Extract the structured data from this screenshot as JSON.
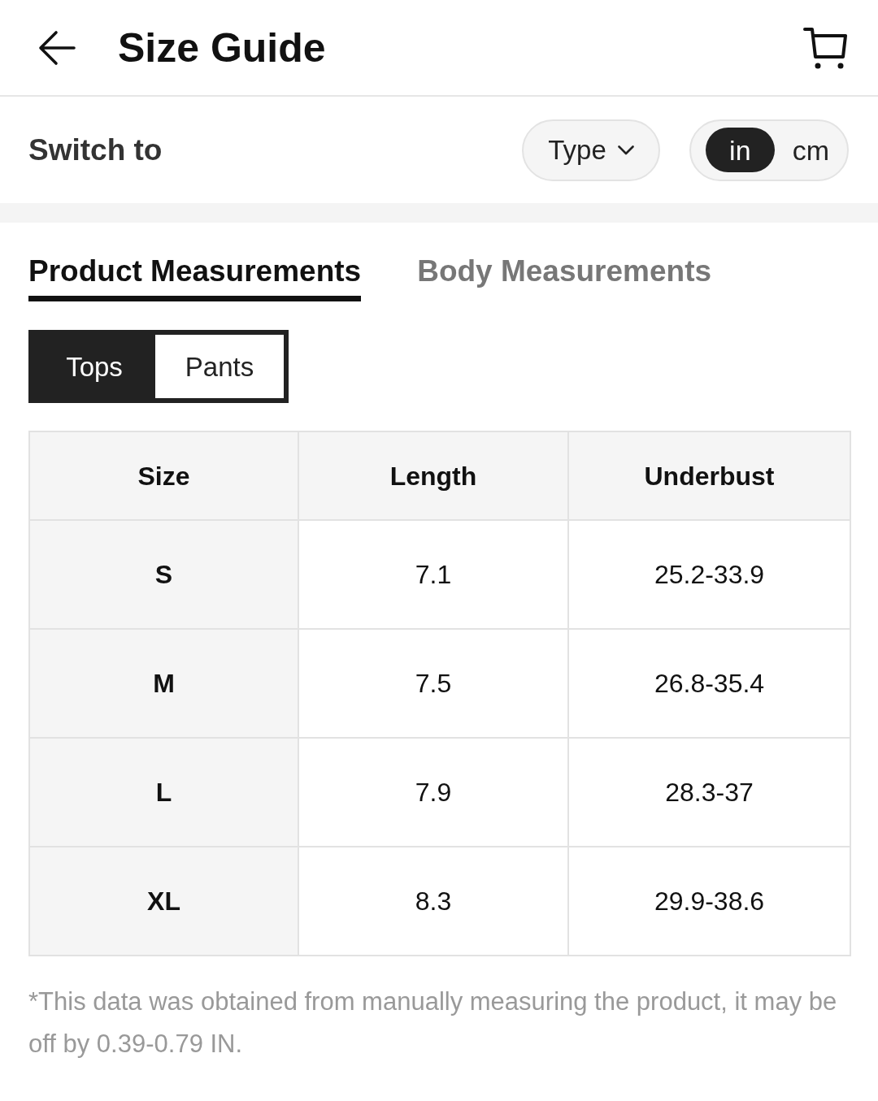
{
  "header": {
    "title": "Size Guide"
  },
  "switch": {
    "label": "Switch to",
    "type_dropdown": {
      "label": "Type"
    },
    "units": [
      {
        "label": "in",
        "selected": true
      },
      {
        "label": "cm",
        "selected": false
      }
    ]
  },
  "tabs": [
    {
      "label": "Product Measurements",
      "selected": true
    },
    {
      "label": "Body Measurements",
      "selected": false
    }
  ],
  "categories": [
    {
      "label": "Tops",
      "selected": true
    },
    {
      "label": "Pants",
      "selected": false
    }
  ],
  "table": {
    "columns": [
      "Size",
      "Length",
      "Underbust"
    ],
    "rows": [
      [
        "S",
        "7.1",
        "25.2-33.9"
      ],
      [
        "M",
        "7.5",
        "26.8-35.4"
      ],
      [
        "L",
        "7.9",
        "28.3-37"
      ],
      [
        "XL",
        "8.3",
        "29.9-38.6"
      ]
    ]
  },
  "note": "*This data was obtained from manually measuring the product, it may be off by 0.39-0.79 IN."
}
